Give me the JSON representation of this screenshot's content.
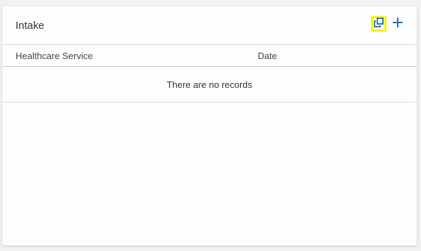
{
  "card": {
    "title": "Intake",
    "actions": {
      "popout_icon": "open-in-new-window-icon",
      "add_icon": "plus-icon",
      "accent_color": "#1f6fb5",
      "highlight_color": "#f5f500"
    }
  },
  "table": {
    "columns": [
      "Healthcare Service",
      "Date"
    ],
    "empty_message": "There are no records",
    "rows": []
  }
}
